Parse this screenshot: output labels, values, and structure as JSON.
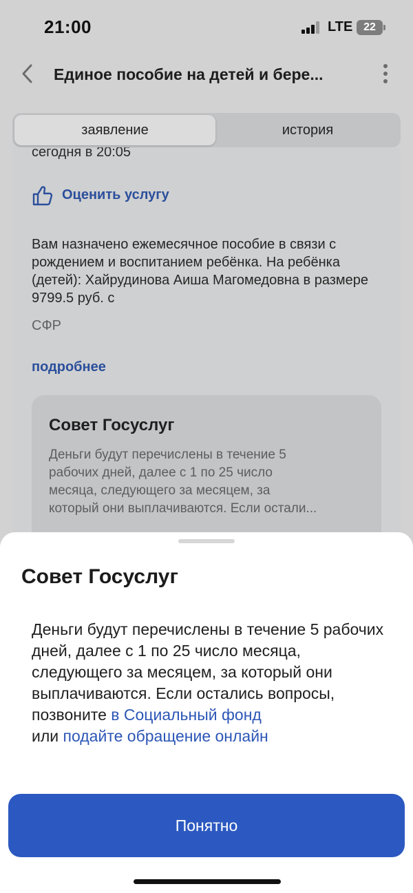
{
  "status_bar": {
    "time": "21:00",
    "network": "LTE",
    "battery": "22"
  },
  "header": {
    "title": "Единое пособие на детей и бере...",
    "back_icon": "chevron-left-icon",
    "more_icon": "more-vertical-icon"
  },
  "tabs": [
    {
      "label": "заявление",
      "active": true
    },
    {
      "label": "история",
      "active": false
    }
  ],
  "content": {
    "cut_text": "сегодня в 20:05",
    "rate_label": "Оценить услугу",
    "rate_icon": "thumbs-up-icon",
    "message": "Вам назначено ежемесячное пособие в связи с рождением и воспитанием ребёнка. На ребёнка (детей): Хайрудинова Аиша Магомедовна в размере 9799.5 руб. с",
    "source": "СФР",
    "more_link": "подробнее",
    "advice_card": {
      "title": "Совет Госуслуг",
      "text_lines": [
        "Деньги будут перечислены в течение 5",
        "рабочих дней, далее с 1 по 25 число",
        "месяца, следующего за месяцем, за",
        "который они выплачиваются. Если остали..."
      ]
    }
  },
  "sheet": {
    "title": "Совет Госуслуг",
    "text_main": "Деньги будут перечислены в течение 5 рабочих дней, далее с 1 по 25 число месяца, следующего за месяцем, за который они выплачиваются. Если остались вопросы, позвоните ",
    "link1": "в Социальный фонд",
    "text_or": "или ",
    "link2": "подайте обращение онлайн",
    "button_label": "Понятно"
  },
  "colors": {
    "accent": "#2c59c1",
    "link": "#2c56b6"
  }
}
